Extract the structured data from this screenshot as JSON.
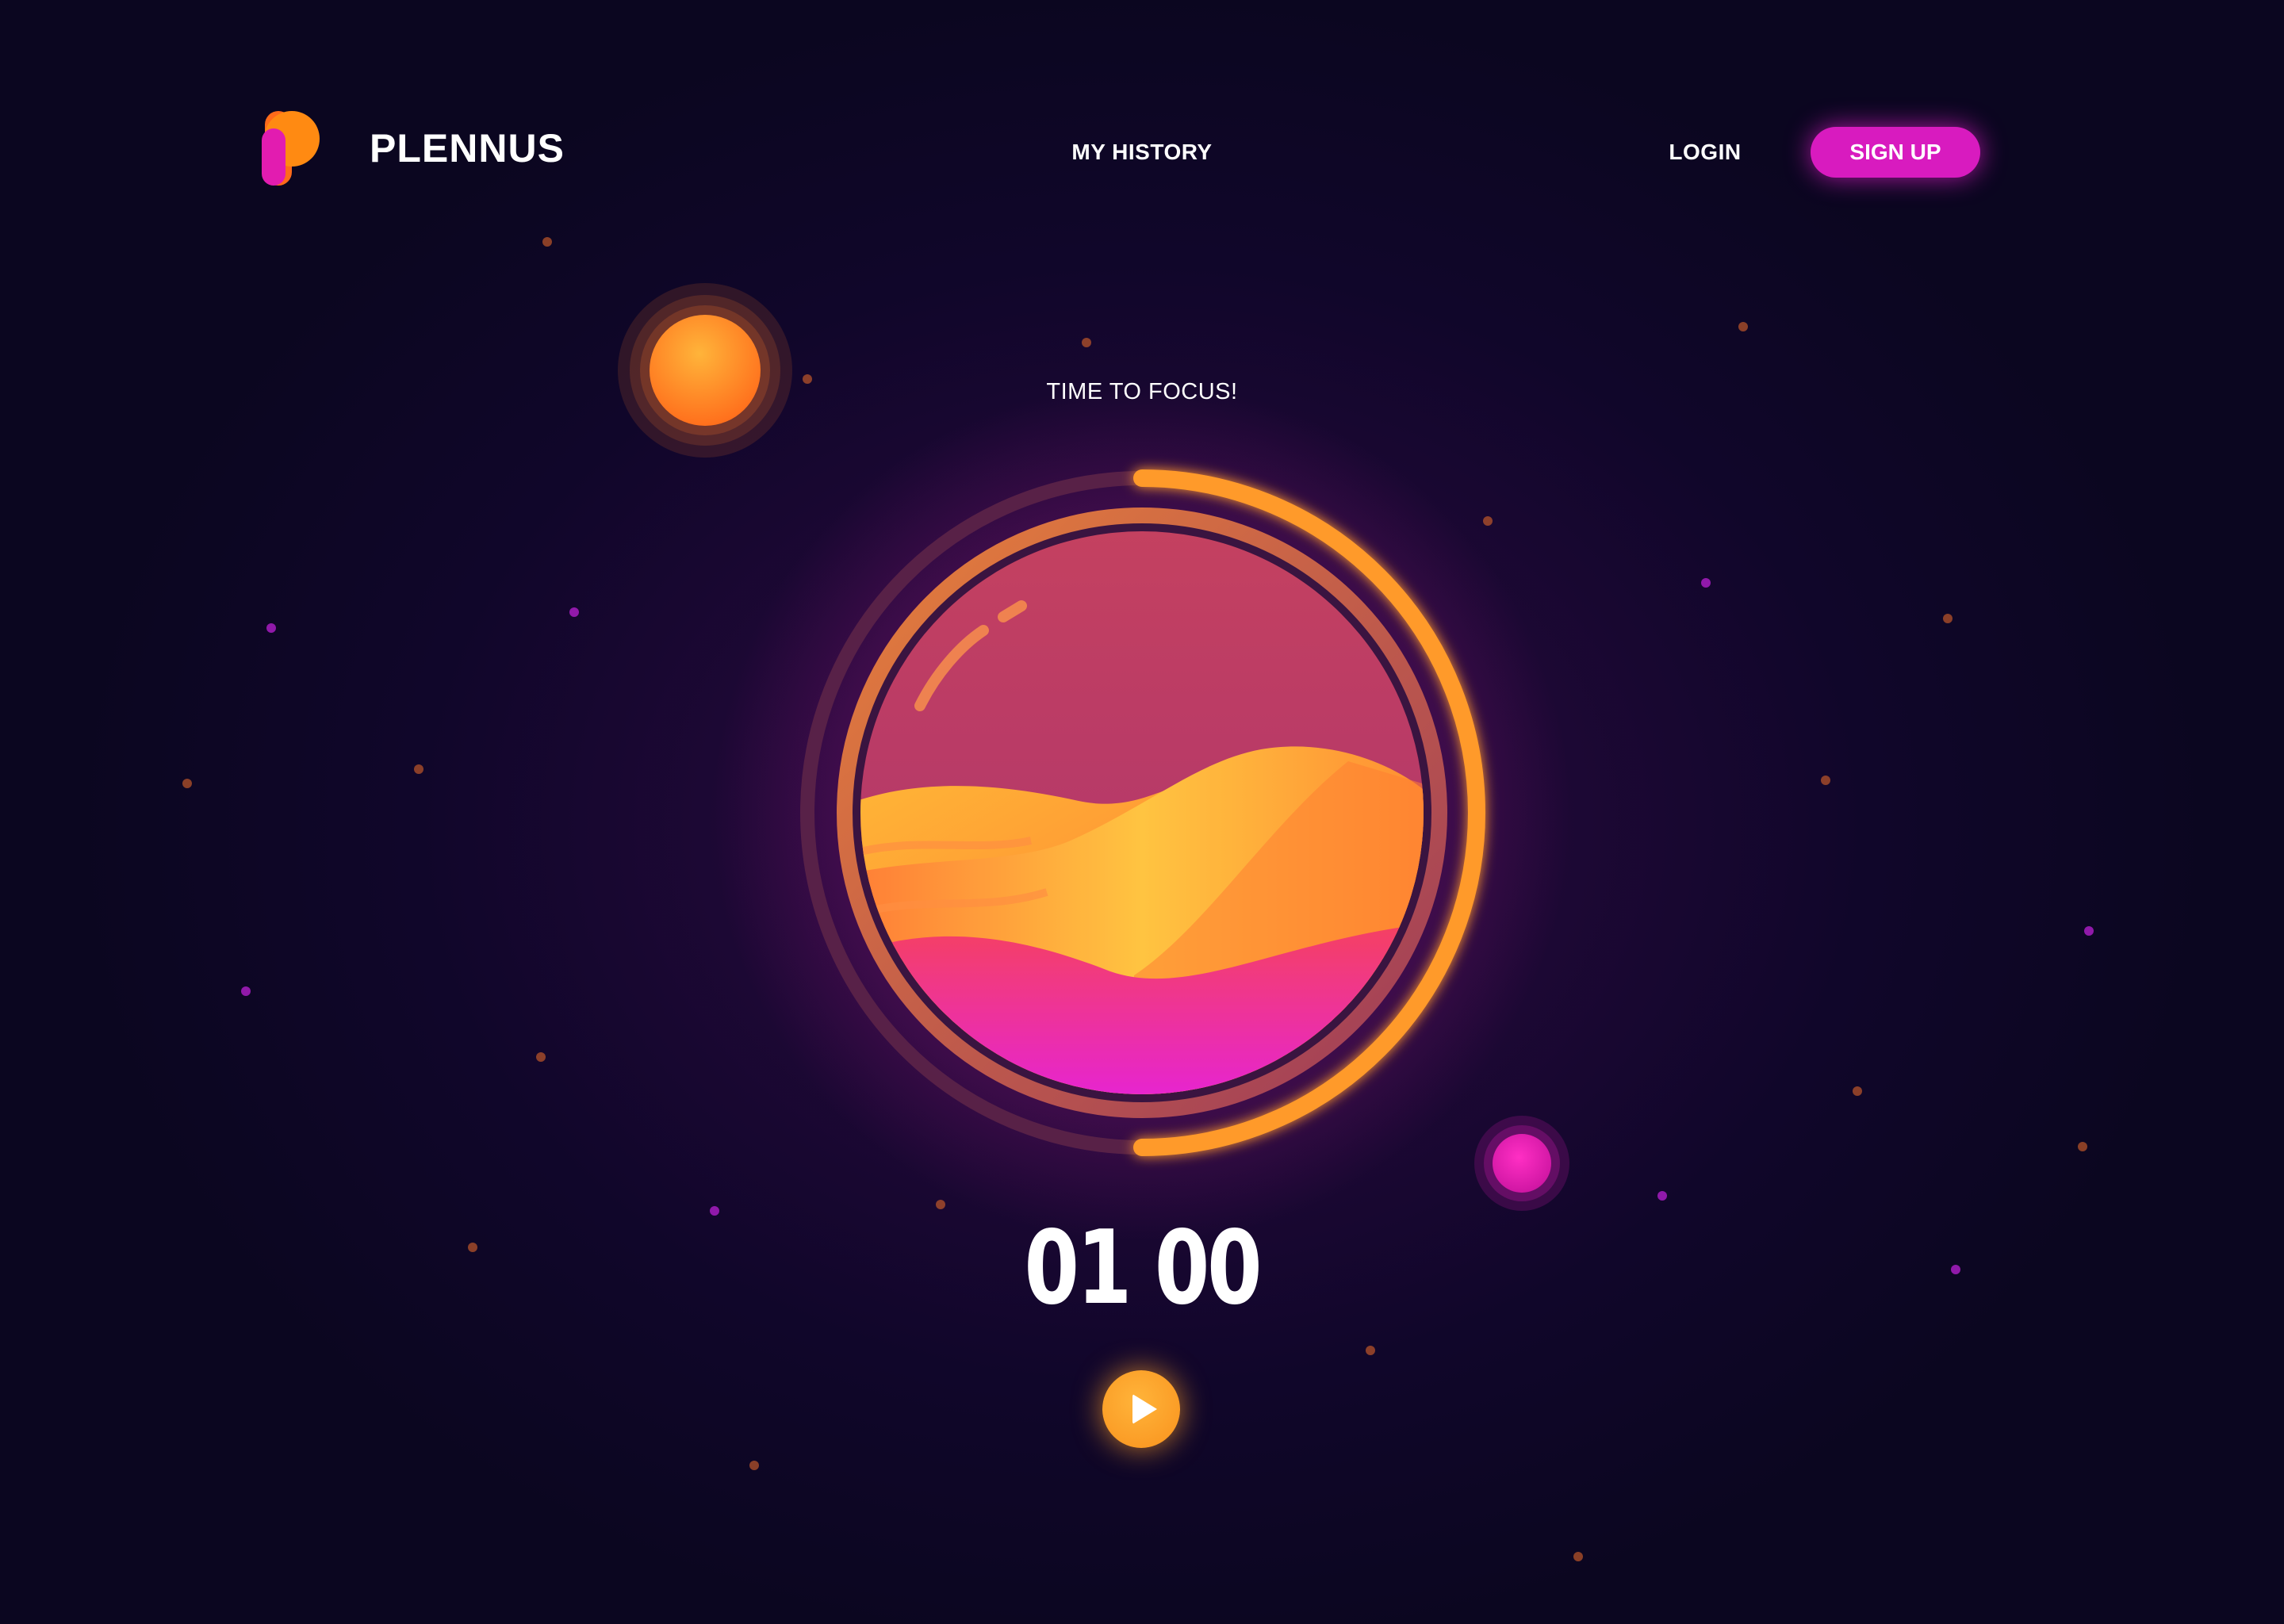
{
  "brand": {
    "name": "PLENNUS",
    "logo_icon": "p-logo-icon"
  },
  "nav": {
    "history_label": "MY HISTORY",
    "login_label": "LOGIN",
    "signup_label": "SIGN UP"
  },
  "focus": {
    "label": "TIME TO FOCUS!",
    "timer": "01 00",
    "progress": 0.5,
    "play_icon": "play-icon"
  },
  "colors": {
    "accent_orange": "#f9921d",
    "accent_magenta": "#d81bbf",
    "background": "#10062a"
  }
}
